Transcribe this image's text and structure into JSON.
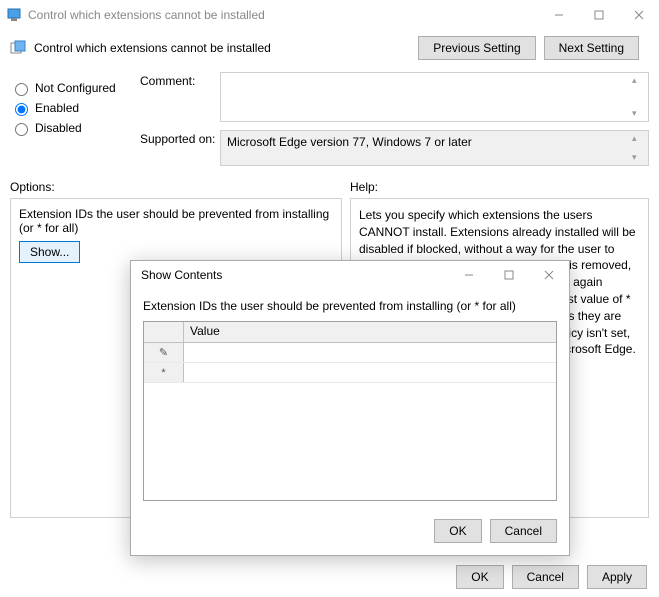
{
  "main_window": {
    "title": "Control which extensions cannot be installed",
    "header_title": "Control which extensions cannot be installed",
    "previous_setting": "Previous Setting",
    "next_setting": "Next Setting",
    "radios": {
      "not_configured": "Not Configured",
      "enabled": "Enabled",
      "disabled": "Disabled",
      "selected": "enabled"
    },
    "comment_label": "Comment:",
    "comment_value": "",
    "supported_label": "Supported on:",
    "supported_value": "Microsoft Edge version 77, Windows 7 or later",
    "options_label": "Options:",
    "help_label": "Help:",
    "options_caption": "Extension IDs the user should be prevented from installing (or * for all)",
    "show_button": "Show...",
    "help_text": "Lets you specify which extensions the users CANNOT install. Extensions already installed will be disabled if blocked, without a way for the user to enable them. After a blocked extension is removed, the user can re-enable it and it will work again unless they are blocked again.\n\nA blocklist value of * means all extensions are blocked unless they are explicitly listed in the allowlist.\n\nIf this policy isn't set, the user can install any extension in Microsoft Edge.",
    "ok": "OK",
    "cancel": "Cancel",
    "apply": "Apply"
  },
  "modal": {
    "title": "Show Contents",
    "caption": "Extension IDs the user should be prevented from installing (or * for all)",
    "column_header": "Value",
    "rows": [
      {
        "marker": "✎",
        "value": ""
      },
      {
        "marker": "*",
        "value": ""
      }
    ],
    "ok": "OK",
    "cancel": "Cancel"
  }
}
